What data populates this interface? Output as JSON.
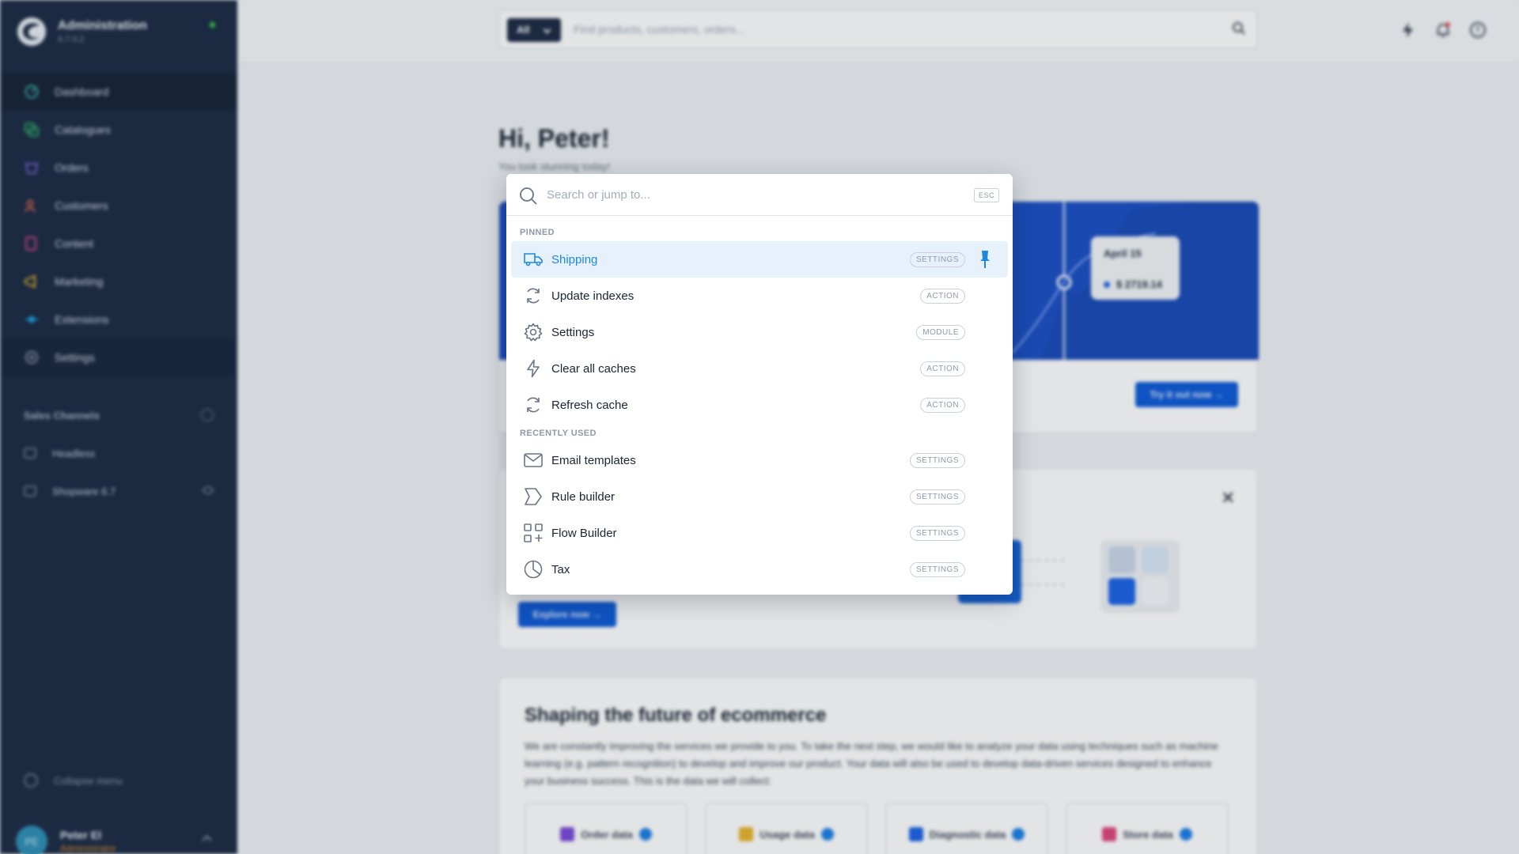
{
  "colors": {
    "sidebar_bg": "#1d2b45",
    "accent": "#1c89dc",
    "selected_row_bg": "#e6f1fc",
    "brand_blue": "#1c4fc4"
  },
  "sidebar": {
    "app_name": "Administration",
    "version": "6.7.0.2",
    "nav": [
      {
        "label": "Dashboard",
        "icon": "dashboard-icon"
      },
      {
        "label": "Catalogues",
        "icon": "catalogue-icon"
      },
      {
        "label": "Orders",
        "icon": "orders-icon"
      },
      {
        "label": "Customers",
        "icon": "customers-icon"
      },
      {
        "label": "Content",
        "icon": "content-icon"
      },
      {
        "label": "Marketing",
        "icon": "megaphone-icon"
      },
      {
        "label": "Extensions",
        "icon": "plugin-icon"
      },
      {
        "label": "Settings",
        "icon": "gear-icon"
      }
    ],
    "sales_channels_title": "Sales Channels",
    "channels": [
      {
        "label": "Headless"
      },
      {
        "label": "Shopware 6.7"
      }
    ],
    "collapse_label": "Collapse menu",
    "user": {
      "initials": "PE",
      "name": "Peter El",
      "role": "Administrator"
    }
  },
  "topbar": {
    "scope_label": "All",
    "search_placeholder": "Find products, customers, orders..."
  },
  "main": {
    "greeting": "Hi, Peter!",
    "subgreeting": "You look stunning today!",
    "tooltip_date": "April 15",
    "tooltip_value": "$ 2719.14",
    "try_button": "Try it out now →",
    "explore_button": "Explore now →",
    "future_title": "Shaping the future of ecommerce",
    "future_text": "We are constantly improving the services we provide to you. To take the next step, we would like to analyze your data using techniques such as machine learning (e.g. pattern recognition) to develop and improve our product. Your data will also be used to develop data-driven services designed to enhance your business success. This is the data we will collect:",
    "data_boxes": [
      {
        "label": "Order data",
        "color": "#7b4ad8"
      },
      {
        "label": "Usage data",
        "color": "#e8b530"
      },
      {
        "label": "Diagnostic data",
        "color": "#1c63e6"
      },
      {
        "label": "Store data",
        "color": "#e0457b"
      }
    ]
  },
  "palette": {
    "placeholder": "Search or jump to...",
    "esc_label": "ESC",
    "pinned_label": "PINNED",
    "recent_label": "RECENTLY USED",
    "pinned": [
      {
        "label": "Shipping",
        "tag": "SETTINGS",
        "icon": "truck-icon"
      },
      {
        "label": "Update indexes",
        "tag": "ACTION",
        "icon": "refresh-icon"
      },
      {
        "label": "Settings",
        "tag": "MODULE",
        "icon": "gear-icon"
      },
      {
        "label": "Clear all caches",
        "tag": "ACTION",
        "icon": "lightning-icon"
      },
      {
        "label": "Refresh cache",
        "tag": "ACTION",
        "icon": "refresh-icon"
      }
    ],
    "recent": [
      {
        "label": "Email templates",
        "tag": "SETTINGS",
        "icon": "envelope-icon"
      },
      {
        "label": "Rule builder",
        "tag": "SETTINGS",
        "icon": "rule-icon"
      },
      {
        "label": "Flow Builder",
        "tag": "SETTINGS",
        "icon": "flow-icon"
      },
      {
        "label": "Tax",
        "tag": "SETTINGS",
        "icon": "pie-icon"
      }
    ]
  }
}
